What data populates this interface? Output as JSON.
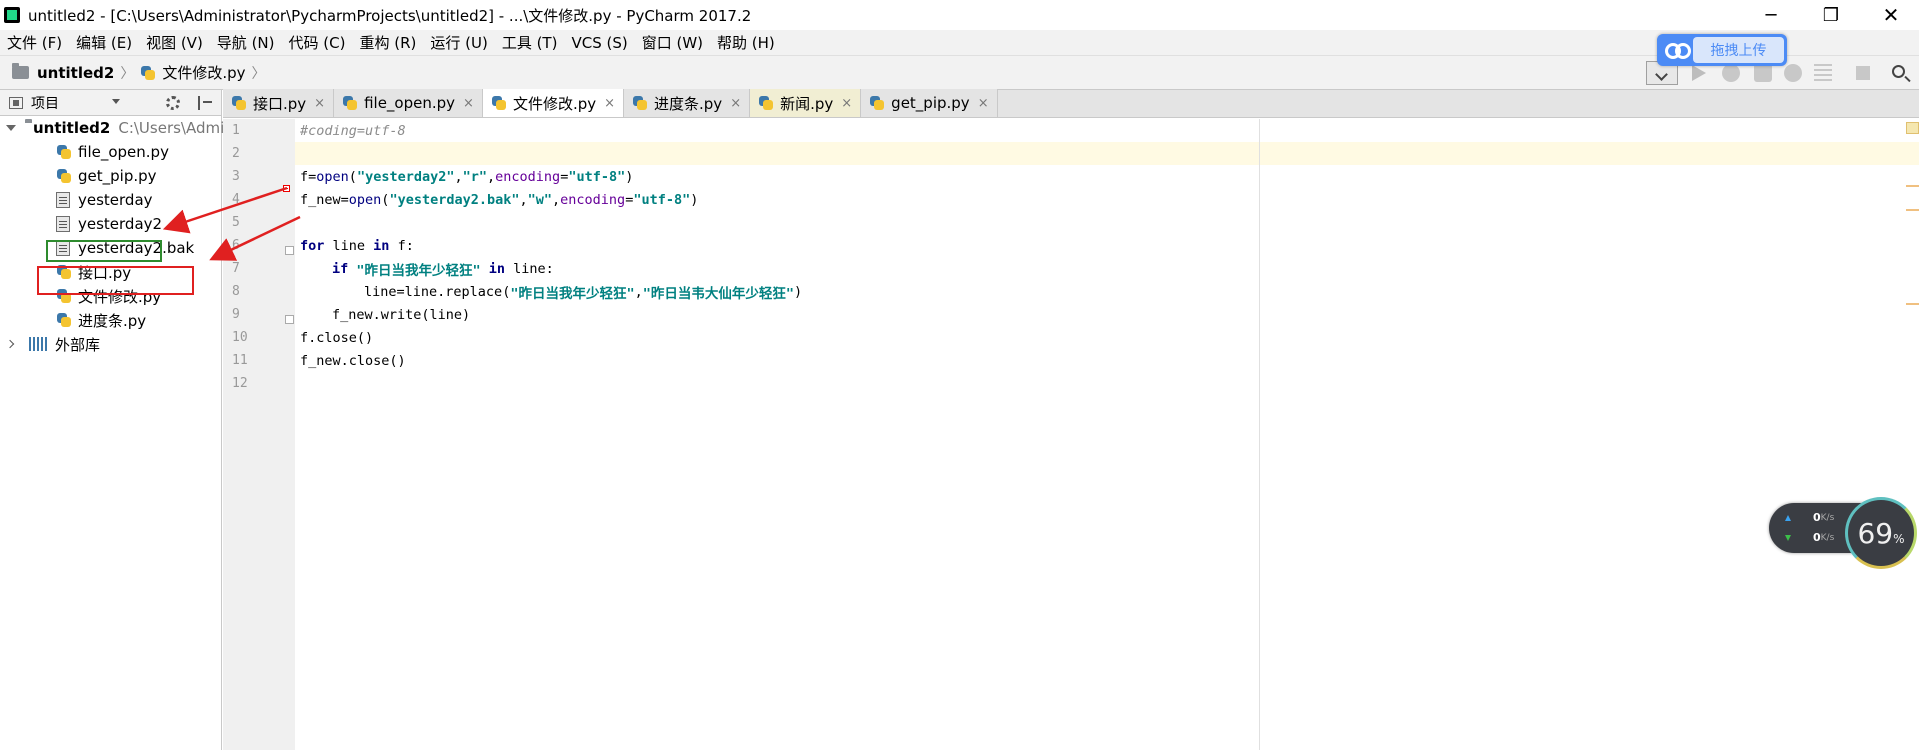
{
  "window": {
    "title": "untitled2 - [C:\\Users\\Administrator\\PycharmProjects\\untitled2] - ...\\文件修改.py - PyCharm 2017.2",
    "minimize": "─",
    "maximize": "❐",
    "close": "✕"
  },
  "menu": [
    "文件 (F)",
    "编辑 (E)",
    "视图 (V)",
    "导航 (N)",
    "代码 (C)",
    "重构 (R)",
    "运行 (U)",
    "工具 (T)",
    "VCS (S)",
    "窗口 (W)",
    "帮助 (H)"
  ],
  "breadcrumb": {
    "project": "untitled2",
    "file": "文件修改.py"
  },
  "baidu": {
    "label": "拖拽上传"
  },
  "project_panel": {
    "title": "项目",
    "root_name": "untitled2",
    "root_path": "C:\\Users\\Admi",
    "files": [
      {
        "name": "file_open.py",
        "type": "py"
      },
      {
        "name": "get_pip.py",
        "type": "py"
      },
      {
        "name": "yesterday",
        "type": "txt"
      },
      {
        "name": "yesterday2",
        "type": "txt"
      },
      {
        "name": "yesterday2.bak",
        "type": "txt"
      },
      {
        "name": "接口.py",
        "type": "py"
      },
      {
        "name": "文件修改.py",
        "type": "py"
      },
      {
        "name": "进度条.py",
        "type": "py"
      }
    ],
    "external": "外部库"
  },
  "tabs": [
    {
      "label": "接口.py",
      "close": "×"
    },
    {
      "label": "file_open.py",
      "close": "×"
    },
    {
      "label": "文件修改.py",
      "close": "×",
      "active": true
    },
    {
      "label": "进度条.py",
      "close": "×"
    },
    {
      "label": "新闻.py",
      "close": "×"
    },
    {
      "label": "get_pip.py",
      "close": "×"
    }
  ],
  "line_numbers": [
    "1",
    "2",
    "3",
    "4",
    "5",
    "6",
    "7",
    "8",
    "9",
    "10",
    "11",
    "12"
  ],
  "code": {
    "l1": "#coding=utf-8",
    "l3": [
      "f",
      "=",
      "open",
      "(",
      "\"yesterday2\"",
      ",",
      "\"r\"",
      ",",
      "encoding",
      "=",
      "\"utf-8\"",
      ")"
    ],
    "l4": [
      "f_new",
      "=",
      "open",
      "(",
      "\"yesterday2.bak\"",
      ",",
      "\"w\"",
      ",",
      "encoding",
      "=",
      "\"utf-8\"",
      ")"
    ],
    "l6": [
      "for",
      " line ",
      "in",
      " f:"
    ],
    "l7": [
      "if",
      " \"昨日当我年少轻狂\" ",
      "in",
      " line:"
    ],
    "l8": [
      "line",
      "=",
      "line.replace(",
      "\"昨日当我年少轻狂\"",
      ",",
      "\"昨日当韦大仙年少轻狂\"",
      ")"
    ],
    "l9": "f_new.write(line)",
    "l10": "f.close()",
    "l11": "f_new.close()"
  },
  "net": {
    "up": "0",
    "down": "0",
    "unit": "K/s",
    "percent": "69",
    "percent_sign": "%"
  },
  "colors": {
    "keyword": "#000080",
    "string": "#008080",
    "kwarg": "#660099",
    "comment": "#8c8c8c",
    "highlight_green": "#2e8b2e",
    "highlight_red": "#e02020",
    "arrow_red": "#e02020"
  }
}
